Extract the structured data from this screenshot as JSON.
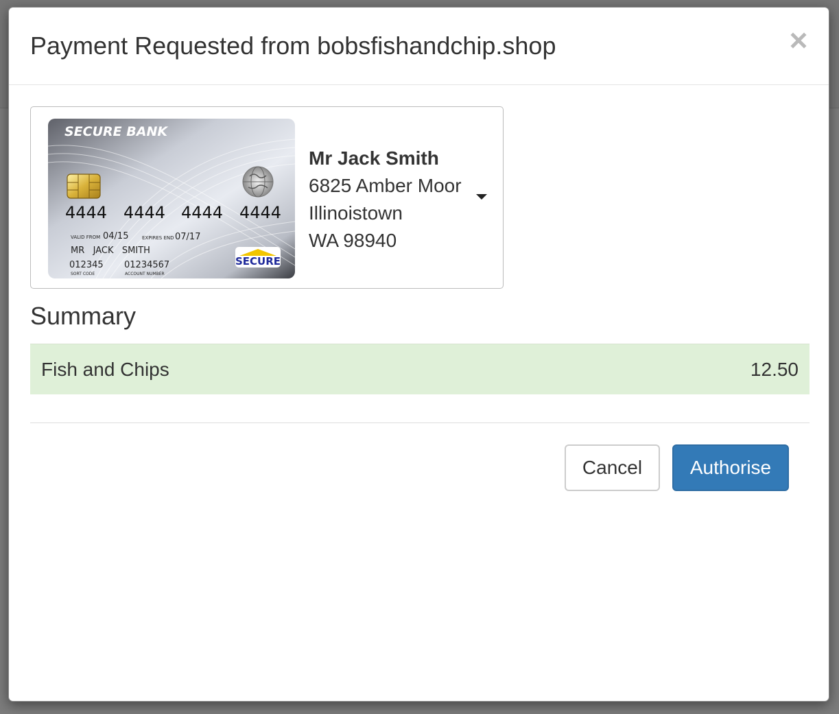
{
  "dialog": {
    "title": "Payment Requested from bobsfishandchip.shop",
    "close_label": "×"
  },
  "card": {
    "bank_name": "SECURE BANK",
    "number_groups": [
      "4444",
      "4444",
      "4444",
      "4444"
    ],
    "valid_from_label": "VALID FROM",
    "valid_from": "04/15",
    "expires_label": "EXPIRES END",
    "expires": "07/17",
    "holder_name": "MR   JACK   SMITH",
    "sort_code": "012345",
    "sort_code_label": "SORT CODE",
    "account_number": "01234567",
    "account_number_label": "ACCOUNT NUMBER",
    "logo_text": "SECURE"
  },
  "billing": {
    "name": "Mr Jack Smith",
    "address_line1": "6825 Amber Moor",
    "city": "Illinoistown",
    "region_postcode": "WA 98940"
  },
  "summary": {
    "heading": "Summary",
    "items": [
      {
        "label": "Fish and Chips",
        "amount": "12.50"
      }
    ]
  },
  "actions": {
    "cancel_label": "Cancel",
    "authorise_label": "Authorise"
  },
  "colors": {
    "primary": "#337ab7",
    "summary_row_bg": "#dff0d8",
    "backdrop": "#7c7c7c"
  }
}
